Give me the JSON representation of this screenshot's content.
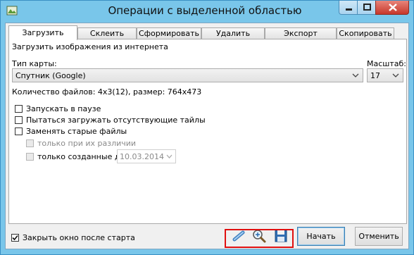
{
  "window": {
    "title": "Операции с выделенной областью"
  },
  "tabs": [
    {
      "label": "Загрузить",
      "active": true
    },
    {
      "label": "Склеить",
      "active": false
    },
    {
      "label": "Сформировать",
      "active": false
    },
    {
      "label": "Удалить",
      "active": false
    },
    {
      "label": "Экспорт",
      "active": false
    },
    {
      "label": "Скопировать",
      "active": false
    }
  ],
  "panel": {
    "heading": "Загрузить изображения из интернета",
    "map_type_label": "Тип карты:",
    "map_type_value": "Спутник (Google)",
    "scale_label": "Масштаб:",
    "scale_value": "17",
    "files_info": "Количество файлов: 4x3(12), размер: 764x473",
    "options": {
      "start_paused": {
        "label": "Запускать в паузе",
        "checked": false
      },
      "retry_missing": {
        "label": "Пытаться загружать отсутствующие тайлы",
        "checked": false
      },
      "replace_old": {
        "label": "Заменять старые файлы",
        "checked": false
      },
      "only_if_different": {
        "label": "только при их различии",
        "checked": false,
        "enabled": false
      },
      "only_created_before": {
        "label": "только созданные до",
        "checked": false,
        "enabled": false,
        "date": "10.03.2014"
      }
    }
  },
  "footer": {
    "close_after_start": {
      "label": "Закрыть окно после старта",
      "checked": true
    },
    "icons": [
      "link-icon",
      "magnifier-icon",
      "save-icon"
    ],
    "start_label": "Начать",
    "cancel_label": "Отменить"
  },
  "colors": {
    "frame": "#79c6ea",
    "highlight": "#e01010",
    "close_button": "#c7372b"
  }
}
